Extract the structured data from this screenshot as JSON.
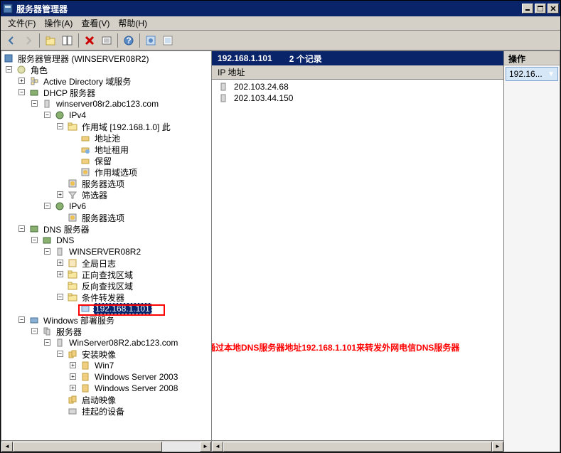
{
  "window": {
    "title": "服务器管理器"
  },
  "menu": {
    "file": "文件(F)",
    "action": "操作(A)",
    "view": "查看(V)",
    "help": "帮助(H)"
  },
  "tree": {
    "root": "服务器管理器 (WINSERVER08R2)",
    "roles": "角色",
    "ad": "Active Directory 域服务",
    "dhcp": "DHCP 服务器",
    "dhcp_host": "winserver08r2.abc123.com",
    "ipv4": "IPv4",
    "scope": "作用域 [192.168.1.0] 此",
    "pool": "地址池",
    "lease": "地址租用",
    "reserve": "保留",
    "scope_opts": "作用域选项",
    "server_opts": "服务器选项",
    "filters": "筛选器",
    "ipv6": "IPv6",
    "ipv6_opts": "服务器选项",
    "dns": "DNS 服务器",
    "dns_sub": "DNS",
    "dns_host": "WINSERVER08R2",
    "globallog": "全局日志",
    "fwd_zones": "正向查找区域",
    "rev_zones": "反向查找区域",
    "cond_fwd": "条件转发器",
    "selected_ip": "192.168.1.101",
    "wds": "Windows 部署服务",
    "servers": "服务器",
    "wds_host": "WinServer08R2.abc123.com",
    "install_img": "安装映像",
    "win7": "Win7",
    "ws2003": "Windows Server 2003",
    "ws2008": "Windows Server 2008",
    "boot_img": "启动映像",
    "pending": "挂起的设备"
  },
  "list": {
    "header_ip": "192.168.1.101",
    "header_count": "2 个记录",
    "col1": "IP 地址",
    "rows": [
      "202.103.24.68",
      "202.103.44.150"
    ]
  },
  "actions": {
    "title": "操作",
    "item1": "192.16..."
  },
  "annotation": {
    "text": "通过本地DNS服务器地址192.168.1.101来转发外网电信DNS服务器"
  }
}
